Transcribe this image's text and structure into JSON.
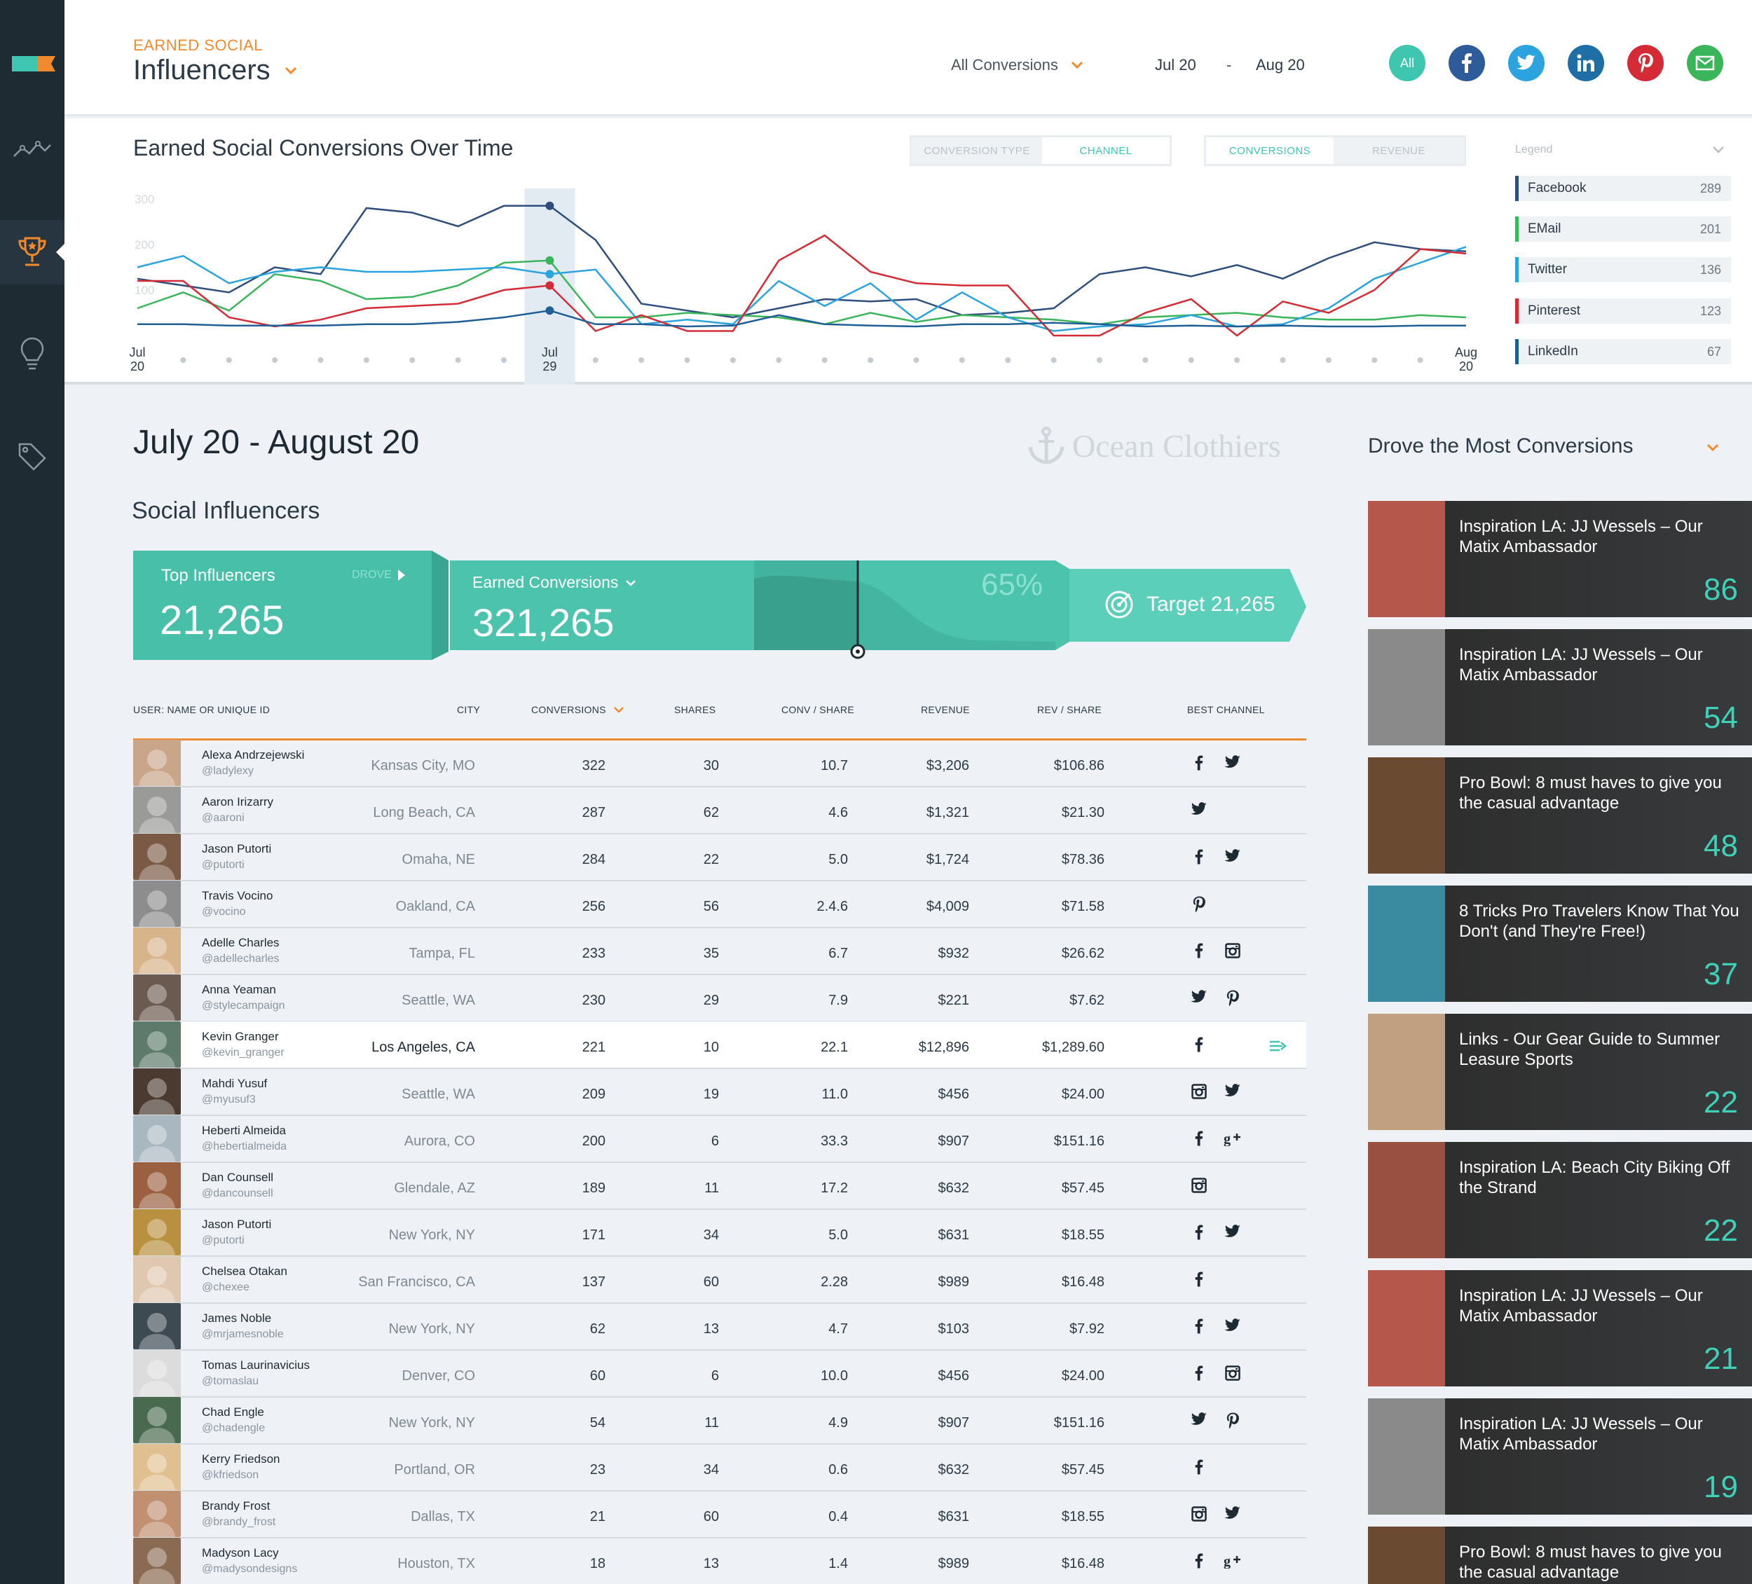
{
  "header": {
    "kicker": "EARNED SOCIAL",
    "title": "Influencers",
    "conversion_filter": "All Conversions",
    "date_from": "Jul 20",
    "date_sep": "-",
    "date_to": "Aug 20",
    "channels": [
      {
        "label": "All",
        "icon": "all-icon",
        "color": "#3ec6b0"
      },
      {
        "label": "",
        "icon": "facebook-icon",
        "color": "#2e5b9a"
      },
      {
        "label": "",
        "icon": "twitter-icon",
        "color": "#2aa3df"
      },
      {
        "label": "",
        "icon": "linkedin-icon",
        "color": "#1f6fa6"
      },
      {
        "label": "",
        "icon": "pinterest-icon",
        "color": "#d42b36"
      },
      {
        "label": "",
        "icon": "email-icon",
        "color": "#3ab55a"
      }
    ]
  },
  "chart": {
    "title": "Earned Social Conversions Over Time",
    "toggle1": [
      "CONVERSION TYPE",
      "CHANNEL"
    ],
    "toggle2": [
      "CONVERSIONS",
      "REVENUE"
    ],
    "legend_title": "Legend",
    "legend": [
      {
        "name": "Facebook",
        "value": "289",
        "color": "#2e4f7e"
      },
      {
        "name": "EMail",
        "value": "201",
        "color": "#3ab55a"
      },
      {
        "name": "Twitter",
        "value": "136",
        "color": "#2aa3df"
      },
      {
        "name": "Pinterest",
        "value": "123",
        "color": "#d42b36"
      },
      {
        "name": "LinkedIn",
        "value": "67",
        "color": "#1f5f96"
      }
    ]
  },
  "chart_data": {
    "type": "line",
    "x_labels": [
      {
        "top": "Jul",
        "bottom": "20"
      },
      {
        "top": "Jul",
        "bottom": "29"
      },
      {
        "top": "Aug",
        "bottom": "20"
      }
    ],
    "y_ticks": [
      "300",
      "200",
      "100"
    ],
    "ylim": [
      0,
      300
    ],
    "highlight_index": 9,
    "series": [
      {
        "name": "Facebook",
        "color": "#2e4f7e",
        "values": [
          125,
          110,
          95,
          150,
          135,
          280,
          270,
          240,
          285,
          285,
          210,
          70,
          55,
          40,
          60,
          80,
          75,
          80,
          45,
          50,
          60,
          135,
          150,
          130,
          155,
          125,
          170,
          205,
          190,
          185
        ]
      },
      {
        "name": "EMail",
        "color": "#3ab55a",
        "values": [
          60,
          95,
          55,
          135,
          120,
          80,
          85,
          110,
          160,
          165,
          40,
          40,
          50,
          45,
          40,
          25,
          50,
          30,
          45,
          40,
          35,
          25,
          40,
          45,
          50,
          40,
          35,
          35,
          45,
          40
        ]
      },
      {
        "name": "Twitter",
        "color": "#2aa3df",
        "values": [
          150,
          175,
          115,
          140,
          150,
          140,
          140,
          145,
          150,
          135,
          145,
          25,
          35,
          25,
          120,
          65,
          115,
          35,
          95,
          40,
          10,
          20,
          25,
          45,
          20,
          25,
          60,
          125,
          160,
          195
        ]
      },
      {
        "name": "Pinterest",
        "color": "#d42b36",
        "values": [
          120,
          120,
          40,
          20,
          35,
          60,
          65,
          70,
          100,
          110,
          10,
          45,
          10,
          10,
          165,
          220,
          140,
          115,
          110,
          110,
          0,
          0,
          50,
          80,
          0,
          75,
          50,
          100,
          190,
          180
        ]
      },
      {
        "name": "LinkedIn",
        "color": "#1f5f96",
        "values": [
          25,
          25,
          22,
          22,
          22,
          25,
          25,
          30,
          40,
          55,
          25,
          25,
          20,
          22,
          45,
          25,
          22,
          20,
          25,
          25,
          28,
          25,
          20,
          22,
          20,
          22,
          20,
          20,
          22,
          22
        ]
      }
    ]
  },
  "summary": {
    "period": "July 20 - August 20",
    "brand": "Ocean Clothiers",
    "section_title": "Social Influencers",
    "top_influencers_label": "Top Influencers",
    "top_influencers_value": "21,265",
    "drove_label": "DROVE",
    "earned_label": "Earned Conversions",
    "earned_value": "321,265",
    "percent": "65%",
    "progress_fraction": 0.65,
    "target_label": "Target 21,265"
  },
  "table": {
    "headers": [
      "USER: NAME OR UNIQUE ID",
      "CITY",
      "CONVERSIONS",
      "SHARES",
      "CONV / SHARE",
      "REVENUE",
      "REV / SHARE",
      "BEST CHANNEL"
    ],
    "rows": [
      {
        "name": "Alexa Andrzejewski",
        "handle": "@ladylexy",
        "city": "Kansas City, MO",
        "conv": "322",
        "shares": "30",
        "cps": "10.7",
        "rev": "$3,206",
        "rps": "$106.86",
        "channels": [
          "facebook",
          "twitter"
        ],
        "avatar": "#c9a58a"
      },
      {
        "name": "Aaron Irizarry",
        "handle": "@aaroni",
        "city": "Long Beach, CA",
        "conv": "287",
        "shares": "62",
        "cps": "4.6",
        "rev": "$1,321",
        "rps": "$21.30",
        "channels": [
          "twitter"
        ],
        "avatar": "#9a9a98"
      },
      {
        "name": "Jason Putorti",
        "handle": "@putorti",
        "city": "Omaha, NE",
        "conv": "284",
        "shares": "22",
        "cps": "5.0",
        "rev": "$1,724",
        "rps": "$78.36",
        "channels": [
          "facebook",
          "twitter"
        ],
        "avatar": "#7a5a44"
      },
      {
        "name": "Travis Vocino",
        "handle": "@vocino",
        "city": "Oakland, CA",
        "conv": "256",
        "shares": "56",
        "cps": "2.4.6",
        "rev": "$4,009",
        "rps": "$71.58",
        "channels": [
          "pinterest"
        ],
        "avatar": "#8d8d8d"
      },
      {
        "name": "Adelle Charles",
        "handle": "@adellecharles",
        "city": "Tampa, FL",
        "conv": "233",
        "shares": "35",
        "cps": "6.7",
        "rev": "$932",
        "rps": "$26.62",
        "channels": [
          "facebook",
          "instagram"
        ],
        "avatar": "#d7b48a"
      },
      {
        "name": "Anna Yeaman",
        "handle": "@stylecampaign",
        "city": "Seattle, WA",
        "conv": "230",
        "shares": "29",
        "cps": "7.9",
        "rev": "$221",
        "rps": "$7.62",
        "channels": [
          "twitter",
          "pinterest"
        ],
        "avatar": "#6b5a50"
      },
      {
        "name": "Kevin Granger",
        "handle": "@kevin_granger",
        "city": "Los Angeles, CA",
        "conv": "221",
        "shares": "10",
        "cps": "22.1",
        "rev": "$12,896",
        "rps": "$1,289.60",
        "channels": [
          "facebook"
        ],
        "avatar": "#5d7a6a"
      },
      {
        "name": "Mahdi Yusuf",
        "handle": "@myusuf3",
        "city": "Seattle, WA",
        "conv": "209",
        "shares": "19",
        "cps": "11.0",
        "rev": "$456",
        "rps": "$24.00",
        "channels": [
          "instagram",
          "twitter"
        ],
        "avatar": "#4a3a30"
      },
      {
        "name": "Heberti Almeida",
        "handle": "@hebertialmeida",
        "city": "Aurora, CO",
        "conv": "200",
        "shares": "6",
        "cps": "33.3",
        "rev": "$907",
        "rps": "$151.16",
        "channels": [
          "facebook",
          "googleplus"
        ],
        "avatar": "#a9b8c0"
      },
      {
        "name": "Dan Counsell",
        "handle": "@dancounsell",
        "city": "Glendale, AZ",
        "conv": "189",
        "shares": "11",
        "cps": "17.2",
        "rev": "$632",
        "rps": "$57.45",
        "channels": [
          "instagram"
        ],
        "avatar": "#9a6040"
      },
      {
        "name": "Jason Putorti",
        "handle": "@putorti",
        "city": "New York, NY",
        "conv": "171",
        "shares": "34",
        "cps": "5.0",
        "rev": "$631",
        "rps": "$18.55",
        "channels": [
          "facebook",
          "twitter"
        ],
        "avatar": "#b89040"
      },
      {
        "name": "Chelsea Otakan",
        "handle": "@chexee",
        "city": "San Francisco, CA",
        "conv": "137",
        "shares": "60",
        "cps": "2.28",
        "rev": "$989",
        "rps": "$16.48",
        "channels": [
          "facebook"
        ],
        "avatar": "#e0c8b0"
      },
      {
        "name": "James Noble",
        "handle": "@mrjamesnoble",
        "city": "New York, NY",
        "conv": "62",
        "shares": "13",
        "cps": "4.7",
        "rev": "$103",
        "rps": "$7.92",
        "channels": [
          "facebook",
          "twitter"
        ],
        "avatar": "#3d4a52"
      },
      {
        "name": "Tomas Laurinavicius",
        "handle": "@tomaslau",
        "city": "Denver, CO",
        "conv": "60",
        "shares": "6",
        "cps": "10.0",
        "rev": "$456",
        "rps": "$24.00",
        "channels": [
          "facebook",
          "instagram"
        ],
        "avatar": "#dcdcdc"
      },
      {
        "name": "Chad Engle",
        "handle": "@chadengle",
        "city": "New York, NY",
        "conv": "54",
        "shares": "11",
        "cps": "4.9",
        "rev": "$907",
        "rps": "$151.16",
        "channels": [
          "twitter",
          "pinterest"
        ],
        "avatar": "#4a6a50"
      },
      {
        "name": "Kerry Friedson",
        "handle": "@kfriedson",
        "city": "Portland, OR",
        "conv": "23",
        "shares": "34",
        "cps": "0.6",
        "rev": "$632",
        "rps": "$57.45",
        "channels": [
          "facebook"
        ],
        "avatar": "#e0c090"
      },
      {
        "name": "Brandy Frost",
        "handle": "@brandy_frost",
        "city": "Dallas, TX",
        "conv": "21",
        "shares": "60",
        "cps": "0.4",
        "rev": "$631",
        "rps": "$18.55",
        "channels": [
          "instagram",
          "twitter"
        ],
        "avatar": "#c09070"
      },
      {
        "name": "Madyson Lacy",
        "handle": "@madysondesigns",
        "city": "Houston, TX",
        "conv": "18",
        "shares": "13",
        "cps": "1.4",
        "rev": "$989",
        "rps": "$16.48",
        "channels": [
          "facebook",
          "googleplus"
        ],
        "avatar": "#8a6a50"
      }
    ]
  },
  "side": {
    "title": "Drove the Most Conversions",
    "cards": [
      {
        "text": "Inspiration LA: JJ Wessels – Our Matix Ambassador",
        "count": "86",
        "thumb": "#b5574a"
      },
      {
        "text": "Inspiration LA: JJ Wessels – Our Matix Ambassador",
        "count": "54",
        "thumb": "#8a8a8a"
      },
      {
        "text": "Pro Bowl: 8 must haves to give you the casual advantage",
        "count": "48",
        "thumb": "#6a4a30"
      },
      {
        "text": "8 Tricks Pro Travelers Know That You Don't (and They're Free!)",
        "count": "37",
        "thumb": "#3a8aa0"
      },
      {
        "text": "Links - Our Gear Guide to Summer Leasure Sports",
        "count": "22",
        "thumb": "#c0a080"
      },
      {
        "text": "Inspiration LA: Beach City Biking Off the Strand",
        "count": "22",
        "thumb": "#9a5040"
      },
      {
        "text": "Inspiration LA: JJ Wessels – Our Matix Ambassador",
        "count": "21",
        "thumb": "#b5574a"
      },
      {
        "text": "Inspiration LA: JJ Wessels – Our Matix Ambassador",
        "count": "19",
        "thumb": "#8a8a8a"
      },
      {
        "text": "Pro Bowl: 8 must haves to give you the casual advantage",
        "count": "",
        "thumb": "#6a4a30"
      }
    ]
  }
}
